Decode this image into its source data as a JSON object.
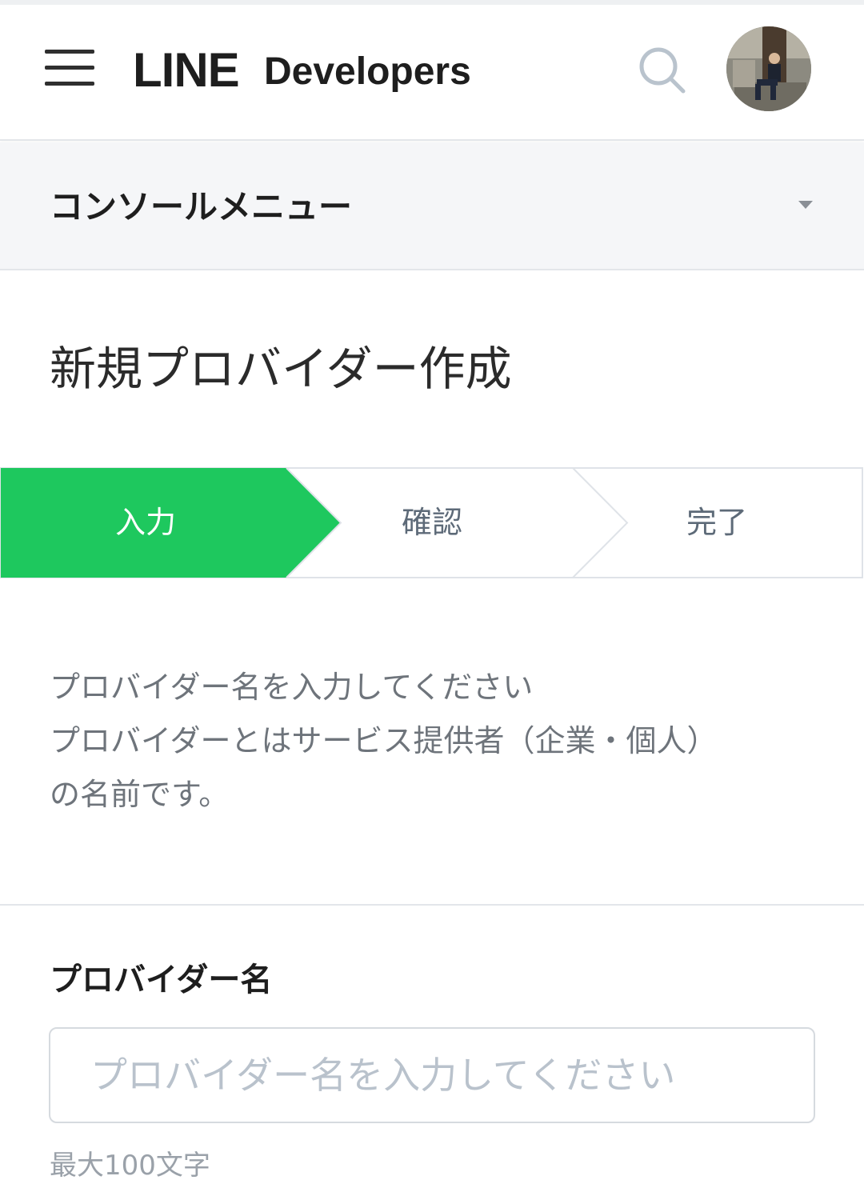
{
  "header": {
    "logo_line": "LINE",
    "logo_developers": "Developers",
    "menu_icon": "hamburger-menu-icon",
    "search_icon": "search-icon",
    "avatar": "user-avatar"
  },
  "console_menu": {
    "label": "コンソールメニュー",
    "icon": "caret-down-icon"
  },
  "page": {
    "title": "新規プロバイダー作成"
  },
  "steps": [
    {
      "label": "入力",
      "active": true
    },
    {
      "label": "確認",
      "active": false
    },
    {
      "label": "完了",
      "active": false
    }
  ],
  "description": {
    "line1": "プロバイダー名を入力してください",
    "line2": "プロバイダーとはサービス提供者（企業・個人）",
    "line3": "の名前です。"
  },
  "form": {
    "provider_name_label": "プロバイダー名",
    "provider_name_placeholder": "プロバイダー名を入力してください",
    "provider_name_value": "",
    "provider_name_hint": "最大100文字"
  },
  "colors": {
    "accent_green": "#1ec85e",
    "border": "#dfe3e8",
    "step_text": "#5d6a78"
  }
}
